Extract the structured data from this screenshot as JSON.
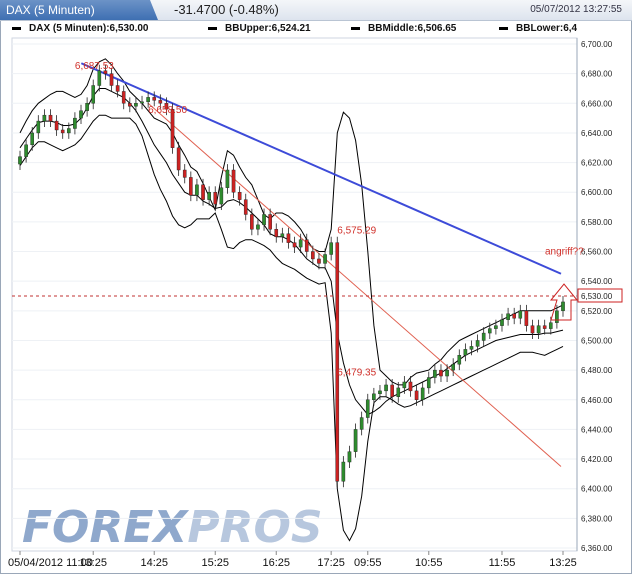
{
  "window": {
    "title": "DAX (5 Minuten)",
    "change": "-31.4700 (-0.48%)",
    "timestamp": "05/07/2012 13:27:55"
  },
  "legend": [
    {
      "label": "DAX (5 Minuten):6,530.00"
    },
    {
      "label": "BBUpper:6,524.21"
    },
    {
      "label": "BBMiddle:6,506.65"
    },
    {
      "label": "BBLower:6,4"
    }
  ],
  "watermark": {
    "part1": "FOREX",
    "part2": "PROS"
  },
  "colors": {
    "up": "#2e8b2e",
    "down": "#cc2222",
    "band": "#000000",
    "trendline": "#3d4bd8",
    "redline": "#e06050",
    "accent": "#4a74b8"
  },
  "chart_data": {
    "type": "candlestick",
    "ylim": [
      6360,
      6700
    ],
    "y_ticks": [
      "6,360.00",
      "6,380.00",
      "6,400.00",
      "6,420.00",
      "6,440.00",
      "6,460.00",
      "6,480.00",
      "6,500.00",
      "6,520.00",
      "6,540.00",
      "6,560.00",
      "6,580.00",
      "6,600.00",
      "6,620.00",
      "6,640.00",
      "6,660.00",
      "6,680.00",
      "6,700.00"
    ],
    "x_ticks": [
      "05/04/2012 11:00",
      "13:25",
      "14:25",
      "15:25",
      "16:25",
      "17:25",
      "09:55",
      "10:55",
      "11:55",
      "13:25"
    ],
    "last_price": "6,530.00",
    "closes": [
      6624,
      6632,
      6640,
      6648,
      6652,
      6648,
      6642,
      6640,
      6643,
      6650,
      6655,
      6660,
      6672,
      6682,
      6680,
      6672,
      6668,
      6660,
      6658,
      6660,
      6661,
      6664,
      6662,
      6660,
      6656,
      6630,
      6615,
      6610,
      6598,
      6605,
      6595,
      6600,
      6592,
      6603,
      6615,
      6600,
      6595,
      6585,
      6575,
      6578,
      6585,
      6575,
      6570,
      6572,
      6566,
      6563,
      6568,
      6560,
      6555,
      6552,
      6558,
      6566,
      6405,
      6418,
      6425,
      6440,
      6448,
      6460,
      6464,
      6466,
      6470,
      6462,
      6468,
      6472,
      6466,
      6460,
      6468,
      6475,
      6480,
      6476,
      6480,
      6484,
      6490,
      6494,
      6496,
      6500,
      6505,
      6508,
      6510,
      6514,
      6518,
      6515,
      6520,
      6510,
      6505,
      6510,
      6508,
      6512,
      6520,
      6526
    ],
    "bb_upper": [
      6640,
      6648,
      6655,
      6660,
      6663,
      6666,
      6668,
      6668,
      6666,
      6664,
      6666,
      6672,
      6683,
      6688,
      6690,
      6686,
      6680,
      6675,
      6668,
      6664,
      6660,
      6655,
      6650,
      6648,
      6646,
      6640,
      6632,
      6625,
      6617,
      6614,
      6606,
      6597,
      6588,
      6610,
      6628,
      6625,
      6617,
      6610,
      6605,
      6595,
      6585,
      6582,
      6586,
      6586,
      6584,
      6580,
      6575,
      6568,
      6562,
      6560,
      6560,
      6575,
      6640,
      6654,
      6650,
      6635,
      6605,
      6560,
      6510,
      6480,
      6476,
      6472,
      6470,
      6470,
      6475,
      6478,
      6479,
      6480,
      6484,
      6487,
      6492,
      6496,
      6500,
      6502,
      6504,
      6506,
      6508,
      6510,
      6512,
      6514,
      6516,
      6518,
      6520,
      6520,
      6520,
      6520,
      6520,
      6520,
      6522,
      6524
    ],
    "bb_middle": [
      6630,
      6636,
      6642,
      6647,
      6648,
      6648,
      6647,
      6645,
      6645,
      6646,
      6650,
      6657,
      6665,
      6670,
      6670,
      6668,
      6666,
      6664,
      6660,
      6655,
      6648,
      6640,
      6632,
      6626,
      6620,
      6612,
      6606,
      6600,
      6598,
      6598,
      6594,
      6592,
      6589,
      6590,
      6594,
      6595,
      6593,
      6590,
      6586,
      6582,
      6578,
      6572,
      6570,
      6570,
      6568,
      6565,
      6560,
      6555,
      6552,
      6549,
      6549,
      6540,
      6505,
      6485,
      6470,
      6460,
      6455,
      6450,
      6452,
      6455,
      6459,
      6462,
      6464,
      6466,
      6468,
      6470,
      6472,
      6474,
      6476,
      6478,
      6481,
      6484,
      6487,
      6490,
      6492,
      6494,
      6496,
      6498,
      6500,
      6501,
      6502,
      6503,
      6504,
      6504,
      6504,
      6504,
      6505,
      6505,
      6506,
      6507
    ],
    "bb_lower": [
      6618,
      6624,
      6630,
      6634,
      6634,
      6632,
      6630,
      6628,
      6630,
      6632,
      6636,
      6642,
      6648,
      6652,
      6652,
      6650,
      6650,
      6650,
      6650,
      6646,
      6638,
      6625,
      6612,
      6602,
      6594,
      6584,
      6578,
      6576,
      6578,
      6582,
      6582,
      6582,
      6586,
      6575,
      6563,
      6562,
      6566,
      6568,
      6568,
      6566,
      6564,
      6561,
      6556,
      6552,
      6550,
      6548,
      6545,
      6542,
      6540,
      6538,
      6539,
      6505,
      6400,
      6372,
      6365,
      6373,
      6395,
      6432,
      6458,
      6462,
      6462,
      6460,
      6457,
      6455,
      6456,
      6458,
      6460,
      6462,
      6464,
      6466,
      6468,
      6470,
      6472,
      6474,
      6476,
      6478,
      6480,
      6482,
      6484,
      6486,
      6488,
      6490,
      6492,
      6492,
      6492,
      6491,
      6490,
      6492,
      6494,
      6496
    ],
    "annotations": [
      {
        "text": "6,687.53",
        "price": 6686
      },
      {
        "text": "6,658.50",
        "price": 6656
      },
      {
        "text": "6,575.29",
        "price": 6575
      },
      {
        "text": "6,479.35",
        "price": 6479
      },
      {
        "text": "angriff??",
        "price": 6550
      }
    ],
    "trendline": {
      "from": 6687,
      "to": 6545
    },
    "fib_line": {
      "from": 6660,
      "to": 6415
    }
  }
}
